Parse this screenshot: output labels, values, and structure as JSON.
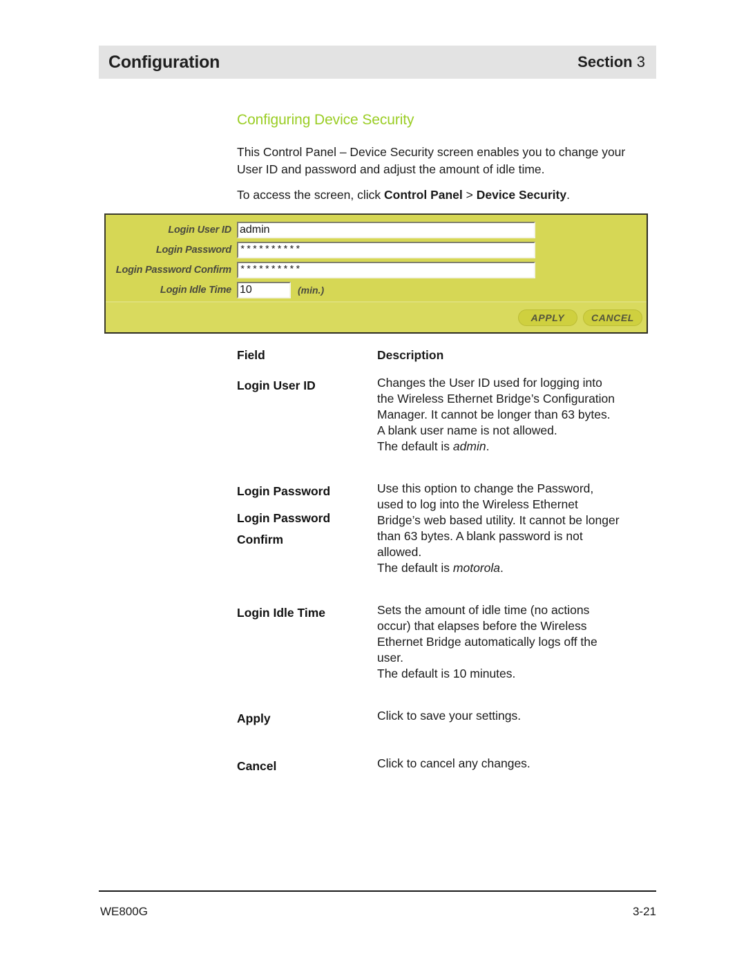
{
  "header": {
    "title": "Configuration",
    "section_word": "Section",
    "section_number": "3"
  },
  "heading": "Configuring Device Security",
  "intro": {
    "paragraph1": "This Control Panel – Device Security screen enables you to change your User ID and password and adjust the amount of idle time.",
    "paragraph2_prefix": "To access the screen, click ",
    "paragraph2_bold1": "Control Panel",
    "paragraph2_sep": " > ",
    "paragraph2_bold2": "Device Security",
    "paragraph2_suffix": "."
  },
  "device_panel": {
    "fields": [
      {
        "label": "Login User ID",
        "value": "admin",
        "type": "text"
      },
      {
        "label": "Login Password",
        "value": "**********",
        "type": "password"
      },
      {
        "label": "Login Password Confirm",
        "value": "**********",
        "type": "password"
      },
      {
        "label": "Login Idle Time",
        "value": "10",
        "type": "number",
        "suffix": "(min.)"
      }
    ],
    "buttons": {
      "apply": "APPLY",
      "cancel": "CANCEL"
    },
    "colors": {
      "panel_background": "#d6d755",
      "footer_background": "#d9da5e",
      "button_background": "#cfd03f",
      "label_text": "#4a4a3f"
    }
  },
  "table": {
    "headers": {
      "field": "Field",
      "description": "Description"
    },
    "rows": [
      {
        "term": "Login User ID",
        "lines": [
          "Changes the User ID used for logging into",
          "the Wireless Ethernet Bridge’s Configuration",
          "Manager. It cannot be longer than 63 bytes.",
          "A blank user name is not allowed."
        ],
        "default_prefix": "The default is ",
        "default_value": "admin",
        "default_italic": true,
        "default_suffix": "."
      },
      {
        "term": "Login Password",
        "term2_line1": "Login Password",
        "term2_line2": "Confirm",
        "lines": [
          "Use this option to change the Password,",
          "used to log into the Wireless Ethernet",
          "Bridge’s web based utility. It cannot be longer",
          "than 63 bytes. A blank password is not",
          "allowed."
        ],
        "default_prefix": "The default is ",
        "default_value": "motorola",
        "default_italic": true,
        "default_suffix": "."
      },
      {
        "term": "Login Idle Time",
        "lines": [
          "Sets the amount of idle time (no actions",
          "occur) that elapses before the Wireless",
          "Ethernet Bridge automatically logs off the",
          "user."
        ],
        "default_prefix": "The default is 10 minutes.",
        "default_value": "",
        "default_italic": false,
        "default_suffix": ""
      },
      {
        "term": "Apply",
        "lines": [
          "Click to save your settings."
        ]
      },
      {
        "term": "Cancel",
        "lines": [
          "Click to cancel any changes."
        ]
      }
    ]
  },
  "footer": {
    "model": "WE800G",
    "page_number": "3-21"
  },
  "accent_colors": {
    "heading_green": "#9acd24",
    "header_bar_gray": "#e3e3e3"
  }
}
